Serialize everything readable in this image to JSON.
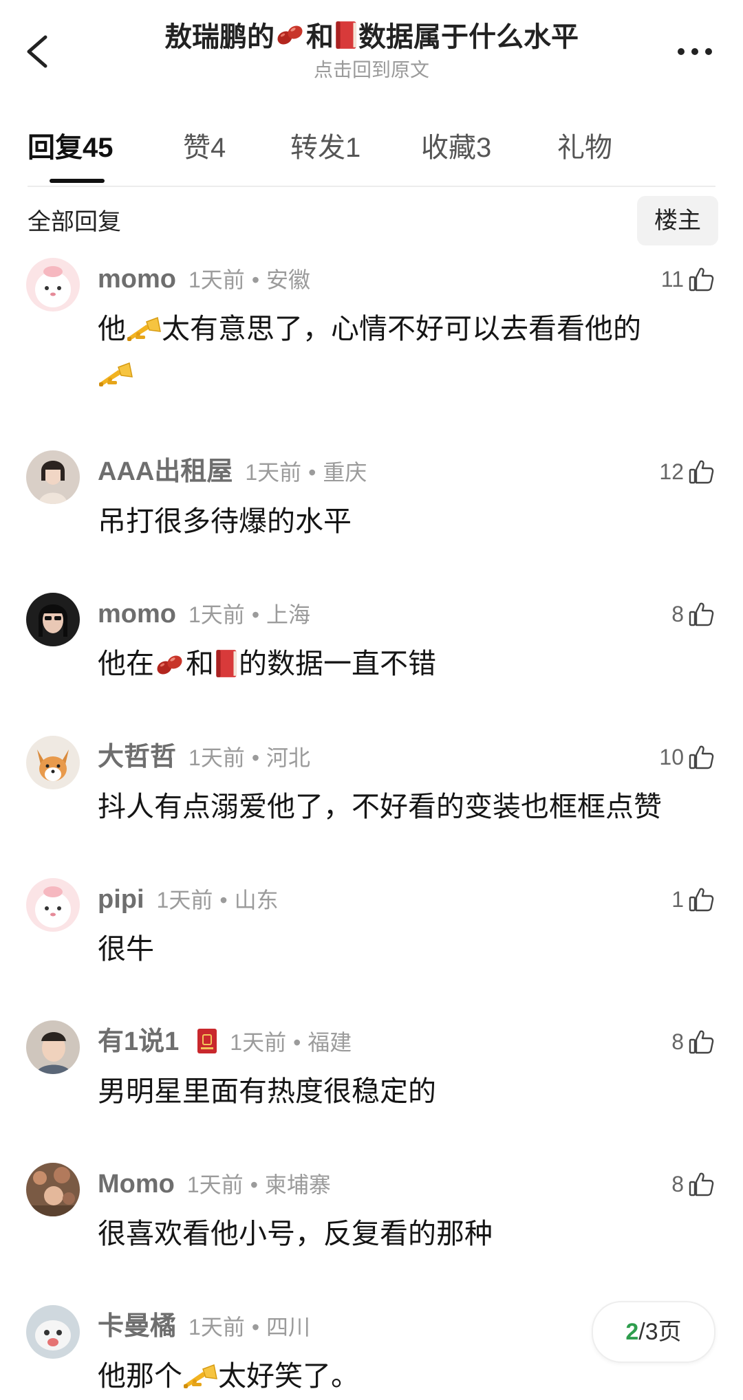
{
  "header": {
    "title_pre": "敖瑞鹏的",
    "title_mid": "和",
    "title_post": "数据属于什么水平",
    "subtitle": "点击回到原文"
  },
  "tabs": [
    {
      "label": "回复",
      "count": "45",
      "active": true
    },
    {
      "label": "赞",
      "count": "4",
      "active": false
    },
    {
      "label": "转发",
      "count": "1",
      "active": false
    },
    {
      "label": "收藏",
      "count": "3",
      "active": false
    },
    {
      "label": "礼物",
      "count": "",
      "active": false
    }
  ],
  "section": {
    "title": "全部回复",
    "louzhu_label": "楼主"
  },
  "comments": [
    {
      "name": "momo",
      "time": "1天前",
      "location": "安徽",
      "likes": "11",
      "text_a": "他",
      "text_b": "太有意思了，心情不好可以去看看他的"
    },
    {
      "name": "AAA出租屋",
      "time": "1天前",
      "location": "重庆",
      "likes": "12",
      "text": "吊打很多待爆的水平"
    },
    {
      "name": "momo",
      "time": "1天前",
      "location": "上海",
      "likes": "8",
      "text_a": "他在",
      "text_b": "和",
      "text_c": "的数据一直不错"
    },
    {
      "name": "大哲哲",
      "time": "1天前",
      "location": "河北",
      "likes": "10",
      "text": "抖人有点溺爱他了，不好看的变装也框框点赞"
    },
    {
      "name": "pipi",
      "time": "1天前",
      "location": "山东",
      "likes": "1",
      "text": "很牛"
    },
    {
      "name": "有1说1",
      "time": "1天前",
      "location": "福建",
      "likes": "8",
      "text": "男明星里面有热度很稳定的"
    },
    {
      "name": "Momo",
      "time": "1天前",
      "location": "柬埔寨",
      "likes": "8",
      "text": "很喜欢看他小号，反复看的那种"
    },
    {
      "name": "卡曼橘",
      "time": "1天前",
      "location": "四川",
      "likes": "",
      "text_a": "他那个",
      "text_b": "太好笑了。"
    }
  ],
  "pagination": {
    "current": "2",
    "total_text": "/3页"
  },
  "icons": [
    "back-arrow-icon",
    "more-icon",
    "red-bean-icon",
    "red-book-icon",
    "trumpet-icon",
    "thumb-up-icon",
    "red-envelope-badge-icon"
  ]
}
